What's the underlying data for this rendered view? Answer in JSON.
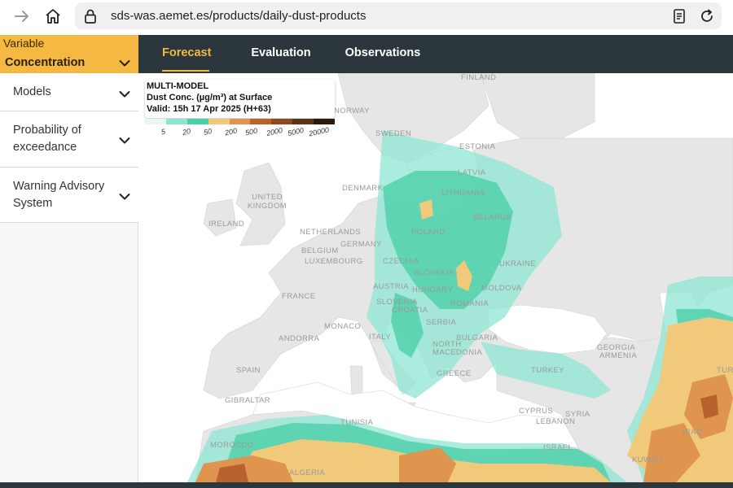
{
  "browser": {
    "url": "sds-was.aemet.es/products/daily-dust-products",
    "icons": [
      "forward-arrow-icon",
      "home-icon",
      "lock-icon",
      "reader-icon",
      "reload-icon"
    ]
  },
  "sidebar": {
    "variable_caption": "Variable",
    "variable_value": "Concentration",
    "items": [
      {
        "label": "Models"
      },
      {
        "label": "Probability of exceedance"
      },
      {
        "label": "Warning Advisory System"
      }
    ]
  },
  "tabs": [
    {
      "label": "Forecast",
      "active": true
    },
    {
      "label": "Evaluation",
      "active": false
    },
    {
      "label": "Observations",
      "active": false
    }
  ],
  "legend": {
    "model": "MULTI-MODEL",
    "product": "Dust Conc. (µg/m³) at Surface",
    "valid": "Valid: 15h 17 Apr 2025 (H+63)",
    "levels": [
      "5",
      "20",
      "50",
      "200",
      "500",
      "2000",
      "5000",
      "20000"
    ],
    "colors": [
      "#e8f7f4",
      "#8ee5d2",
      "#4ccfa9",
      "#f1c97a",
      "#e0954f",
      "#b8632e",
      "#8a4a22",
      "#5b3418",
      "#2a190c"
    ]
  },
  "map_labels": [
    "FINLAND",
    "NORWAY",
    "SWEDEN",
    "ESTONIA",
    "LATVIA",
    "DENMARK",
    "LITHUANIA",
    "UNITED KINGDOM",
    "IRELAND",
    "BELARUS",
    "NETHERLANDS",
    "GERMANY",
    "POLAND",
    "BELGIUM",
    "LUXEMBOURG",
    "CZECHIA",
    "SLOVAKIA",
    "UKRAINE",
    "AUSTRIA",
    "HUNGARY",
    "MOLDOVA",
    "FRANCE",
    "SLOVENIA",
    "CROATIA",
    "ROMANIA",
    "MONACO",
    "SERBIA",
    "ANDORRA",
    "ITALY",
    "BULGARIA",
    "NORTH MACEDONIA",
    "GEORGIA",
    "ARMENIA",
    "SPAIN",
    "GREECE",
    "TURKEY",
    "TURKME",
    "GIBRALTAR",
    "CYPRUS",
    "SYRIA",
    "LEBANON",
    "IRAQ",
    "TUNISIA",
    "MOROCCO",
    "ISRAEL",
    "KUWAIT",
    "ALGERIA"
  ]
}
